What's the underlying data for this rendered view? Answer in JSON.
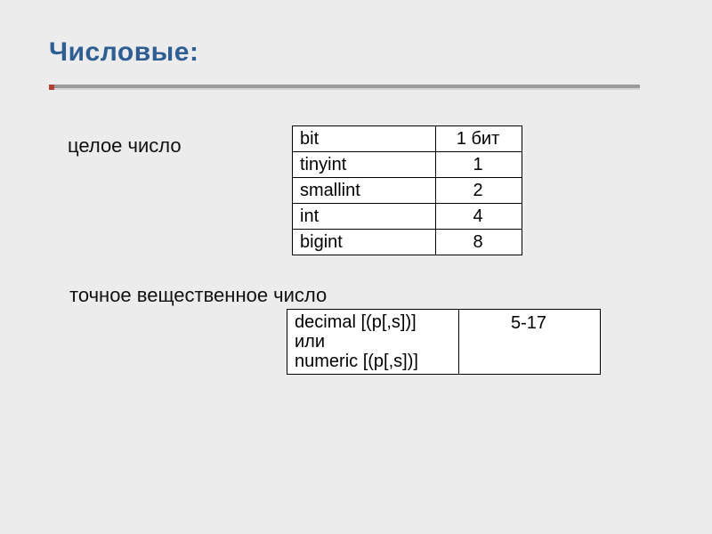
{
  "title": "Числовые:",
  "section_int": {
    "label": "целое число",
    "rows": [
      {
        "name": "bit",
        "size": "1 бит"
      },
      {
        "name": "tinyint",
        "size": "1"
      },
      {
        "name": "smallint",
        "size": "2"
      },
      {
        "name": "int",
        "size": "4"
      },
      {
        "name": "bigint",
        "size": "8"
      }
    ]
  },
  "section_dec": {
    "label": "точное вещественное число",
    "row": {
      "line1": "decimal [(p[,s])]",
      "line2": "или",
      "line3": "numeric [(p[,s])]",
      "size": "5-17"
    }
  },
  "chart_data": {
    "type": "table",
    "tables": [
      {
        "title": "целое число",
        "columns": [
          "type",
          "size_bytes"
        ],
        "rows": [
          [
            "bit",
            "1 бит"
          ],
          [
            "tinyint",
            "1"
          ],
          [
            "smallint",
            "2"
          ],
          [
            "int",
            "4"
          ],
          [
            "bigint",
            "8"
          ]
        ]
      },
      {
        "title": "точное вещественное число",
        "columns": [
          "type",
          "size_bytes"
        ],
        "rows": [
          [
            "decimal [(p[,s])] или numeric [(p[,s])]",
            "5-17"
          ]
        ]
      }
    ]
  }
}
